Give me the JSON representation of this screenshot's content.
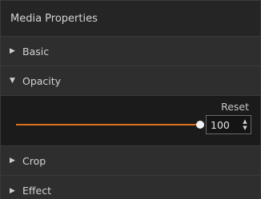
{
  "panel": {
    "title": "Media Properties"
  },
  "sections": {
    "basic": {
      "label": "Basic",
      "expanded": false
    },
    "opacity": {
      "label": "Opacity",
      "expanded": true,
      "reset_label": "Reset",
      "value": "100",
      "slider_fraction": 1.0
    },
    "crop": {
      "label": "Crop",
      "expanded": false
    },
    "effect": {
      "label": "Effect",
      "expanded": false
    }
  },
  "icons": {
    "collapsed": "triangle-right-icon",
    "expanded": "triangle-down-icon",
    "stepper_up": "chevron-up-icon",
    "stepper_down": "chevron-down-icon"
  },
  "colors": {
    "accent": "#e0701f",
    "panel_bg": "#2b2b2b",
    "body_bg": "#1b1b1b"
  }
}
